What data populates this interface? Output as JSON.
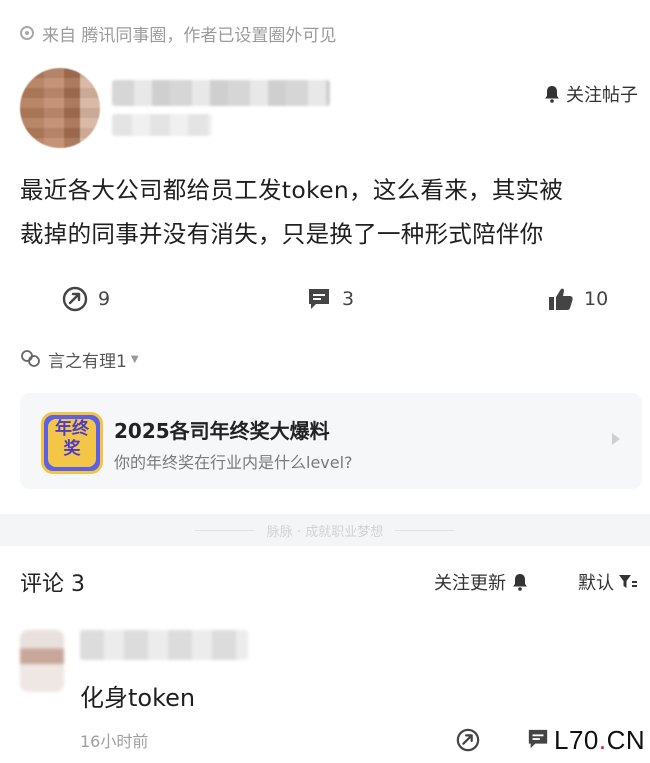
{
  "source": {
    "text": "来自 腾讯同事圈，作者已设置圈外可见"
  },
  "header": {
    "follow_post_label": "关注帖子"
  },
  "post": {
    "line1": "最近各大公司都给员工发token，这么看来，其实被",
    "line2": "裁掉的同事并没有消失，只是换了一种形式陪伴你"
  },
  "actions": {
    "share_count": "9",
    "comment_count": "3",
    "like_count": "10"
  },
  "tag": {
    "label": "言之有理1"
  },
  "card": {
    "icon_text": "年终奖",
    "title": "2025各司年终奖大爆料",
    "subtitle": "你的年终奖在行业内是什么level?"
  },
  "divider": {
    "text": "脉脉 · 成就职业梦想"
  },
  "comments": {
    "title": "评论 3",
    "follow_updates_label": "关注更新",
    "sort_label": "默认",
    "items": [
      {
        "text": "化身token",
        "time": "16小时前"
      }
    ]
  },
  "watermark": {
    "prefix": "L70",
    "dot": ".",
    "suffix": "CN"
  },
  "colors": {
    "accent_blue": "#5a61e6",
    "icon_yellow": "#f3c648",
    "watermark_red": "#d6201f"
  }
}
